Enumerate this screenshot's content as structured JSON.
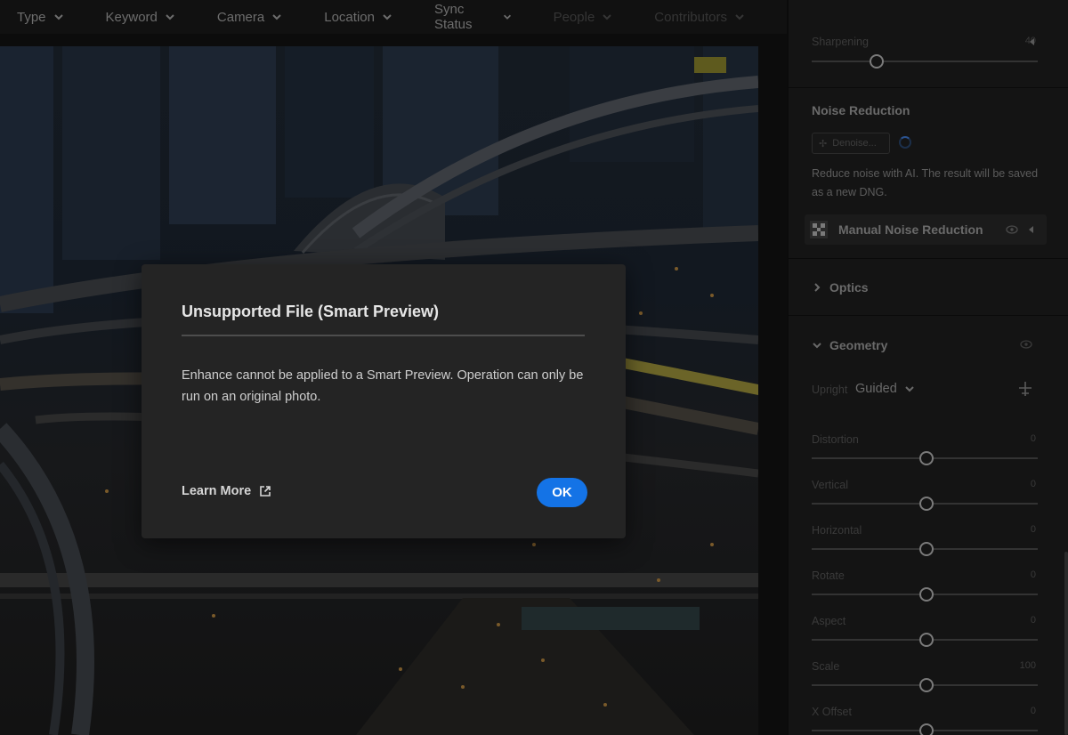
{
  "filters": [
    {
      "label": "Type",
      "enabled": true
    },
    {
      "label": "Keyword",
      "enabled": true
    },
    {
      "label": "Camera",
      "enabled": true
    },
    {
      "label": "Location",
      "enabled": true
    },
    {
      "label": "Sync Status",
      "enabled": true
    },
    {
      "label": "People",
      "enabled": false
    },
    {
      "label": "Contributors",
      "enabled": false
    }
  ],
  "detail": {
    "sharpening": {
      "label": "Sharpening",
      "value": "40"
    }
  },
  "noise_reduction": {
    "title": "Noise Reduction",
    "denoise_label": "Denoise...",
    "description": "Reduce noise with AI. The result will be saved as a new DNG.",
    "manual_label": "Manual Noise Reduction"
  },
  "optics": {
    "title": "Optics"
  },
  "geometry": {
    "title": "Geometry",
    "upright_label": "Upright",
    "upright_value": "Guided",
    "sliders": [
      {
        "label": "Distortion",
        "value": "0"
      },
      {
        "label": "Vertical",
        "value": "0"
      },
      {
        "label": "Horizontal",
        "value": "0"
      },
      {
        "label": "Rotate",
        "value": "0"
      },
      {
        "label": "Aspect",
        "value": "0"
      },
      {
        "label": "Scale",
        "value": "100"
      },
      {
        "label": "X Offset",
        "value": "0"
      }
    ]
  },
  "dialog": {
    "title": "Unsupported File (Smart Preview)",
    "message": "Enhance cannot be applied to a Smart Preview. Operation can only be run on an original photo.",
    "learn_more": "Learn More",
    "ok": "OK"
  },
  "colors": {
    "accent": "#1473e6",
    "dialog_bg": "#242424",
    "panel_bg": "#141414"
  },
  "icons": {
    "filter_chevron": "chevron-down-icon",
    "external_link": "external-link-icon",
    "visibility": "eye-icon",
    "section_toggle": "caret-icon",
    "upright_tool": "crosshair-icon"
  }
}
